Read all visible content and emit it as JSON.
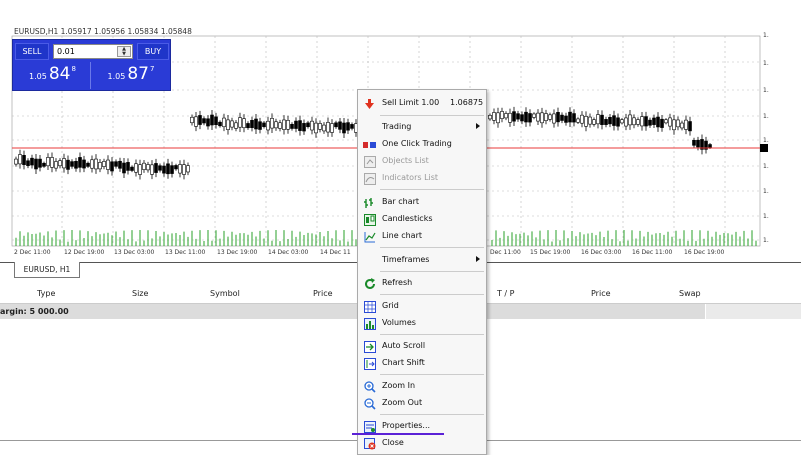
{
  "chart": {
    "title": "EURUSD,H1  1.05917 1.05956 1.05834 1.05848",
    "one_click": {
      "sell_label": "SELL",
      "buy_label": "BUY",
      "lot_value": "0.01",
      "sell_price_small": "1.05",
      "sell_price_big": "84",
      "sell_price_sup": "8",
      "buy_price_small": "1.05",
      "buy_price_big": "87",
      "buy_price_sup": "7"
    },
    "right_labels": [
      "1.",
      "1.",
      "1.",
      "1.",
      "1.",
      "1.",
      "1.",
      "1.",
      "1."
    ],
    "x_labels_left": [
      "2 Dec 11:00",
      "12 Dec 19:00",
      "13 Dec 03:00",
      "13 Dec 11:00",
      "13 Dec 19:00",
      "14 Dec 03:00",
      "14 Dec 11"
    ],
    "x_labels_right": [
      "Dec 11:00",
      "15 Dec 19:00",
      "16 Dec 03:00",
      "16 Dec 11:00",
      "16 Dec 19:00"
    ],
    "colors": {
      "current_price_line": "#e83a3a",
      "grid": "#b9b9b9",
      "bars": "#000000"
    }
  },
  "tab": {
    "label": "EURUSD, H1"
  },
  "table": {
    "headers": [
      "Type",
      "Size",
      "Symbol",
      "Price",
      "T / P",
      "Price",
      "Swap"
    ],
    "margin_text": "argin: 5 000.00"
  },
  "context_menu": {
    "items": [
      {
        "label": "Sell Limit 1.00",
        "extra": "1.06875",
        "icon": "sell-limit-icon",
        "disabled": false
      },
      {
        "label": "Trading",
        "icon": "",
        "submenu": true,
        "disabled": false
      },
      {
        "label": "One Click Trading",
        "icon": "one-click-trading-icon",
        "disabled": false
      },
      {
        "label": "Objects List",
        "icon": "objects-list-icon",
        "disabled": true
      },
      {
        "label": "Indicators List",
        "icon": "indicators-list-icon",
        "disabled": true
      },
      {
        "label": "Bar chart",
        "icon": "bar-chart-icon",
        "disabled": false
      },
      {
        "label": "Candlesticks",
        "icon": "candlesticks-icon",
        "disabled": false
      },
      {
        "label": "Line chart",
        "icon": "line-chart-icon",
        "disabled": false
      },
      {
        "label": "Timeframes",
        "icon": "",
        "submenu": true,
        "disabled": false
      },
      {
        "label": "Refresh",
        "icon": "refresh-icon",
        "disabled": false
      },
      {
        "label": "Grid",
        "icon": "grid-icon",
        "disabled": false
      },
      {
        "label": "Volumes",
        "icon": "volumes-icon",
        "disabled": false
      },
      {
        "label": "Auto Scroll",
        "icon": "auto-scroll-icon",
        "disabled": false
      },
      {
        "label": "Chart Shift",
        "icon": "chart-shift-icon",
        "disabled": false
      },
      {
        "label": "Zoom In",
        "icon": "zoom-in-icon",
        "disabled": false
      },
      {
        "label": "Zoom Out",
        "icon": "zoom-out-icon",
        "disabled": false
      },
      {
        "label": "Properties...",
        "icon": "properties-icon",
        "disabled": false
      },
      {
        "label": "Close",
        "icon": "close-icon",
        "disabled": false
      }
    ]
  }
}
